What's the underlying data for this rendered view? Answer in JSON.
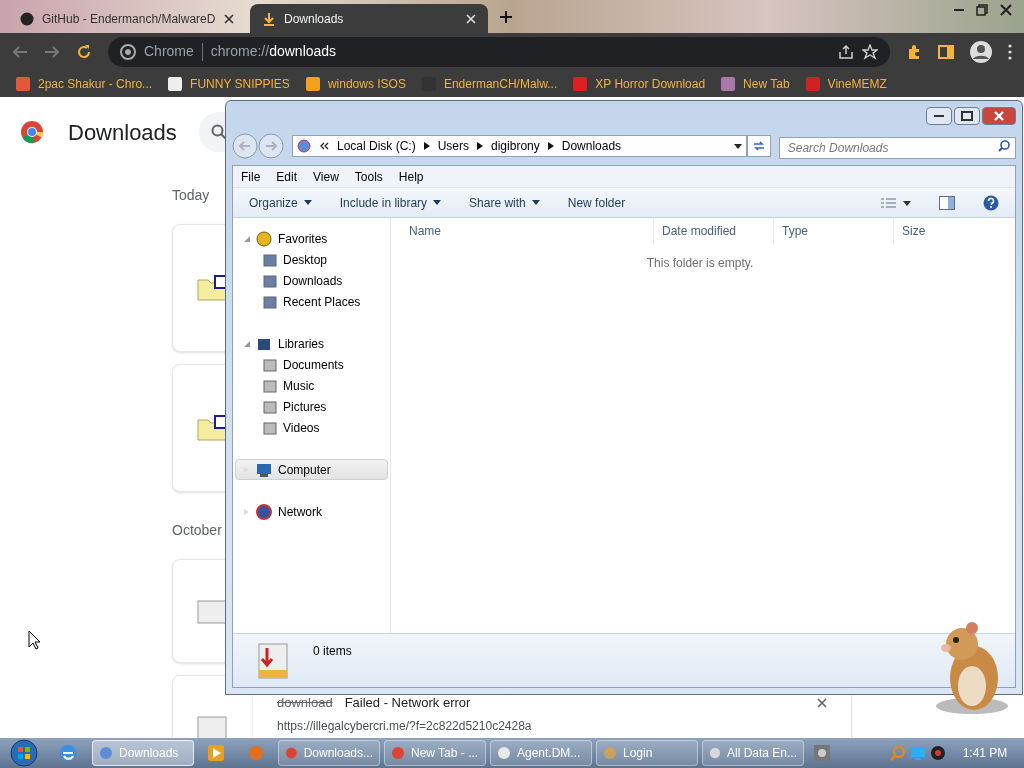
{
  "chrome": {
    "tabs": [
      {
        "title": "GitHub - Endermanch/MalwareD",
        "selected": false
      },
      {
        "title": "Downloads",
        "selected": true
      }
    ],
    "omnibox": {
      "site_label": "Chrome",
      "url_scheme": "chrome://",
      "url_host": "downloads"
    },
    "bookmarks": [
      "2pac Shakur - Chro...",
      "FUNNY SNIPPIES",
      "windows ISOS",
      "EndermanCH/Malw...",
      "XP Horror Download",
      "New Tab",
      "VineMEMZ"
    ],
    "page": {
      "title": "Downloads",
      "sections": [
        {
          "heading": "Today"
        },
        {
          "heading": "October"
        }
      ],
      "failed_item": {
        "name": "download",
        "status": "Failed - Network error",
        "url": "https://illegalcybercri.me/?f=2c822d5210c2428a"
      }
    }
  },
  "explorer": {
    "breadcrumb": [
      "Local Disk (C:)",
      "Users",
      "digibrony",
      "Downloads"
    ],
    "search": {
      "placeholder": "Search Downloads"
    },
    "menu": [
      "File",
      "Edit",
      "View",
      "Tools",
      "Help"
    ],
    "commands": [
      {
        "label": "Organize",
        "dropdown": true
      },
      {
        "label": "Include in library",
        "dropdown": true
      },
      {
        "label": "Share with",
        "dropdown": true
      },
      {
        "label": "New folder",
        "dropdown": false
      }
    ],
    "columns": [
      "Name",
      "Date modified",
      "Type",
      "Size"
    ],
    "empty_message": "This folder is empty.",
    "nav": [
      {
        "label": "Favorites",
        "selected": false,
        "children": [
          {
            "label": "Desktop",
            "selected": false
          },
          {
            "label": "Downloads",
            "selected": false
          },
          {
            "label": "Recent Places",
            "selected": false
          }
        ]
      },
      {
        "label": "Libraries",
        "selected": false,
        "children": [
          {
            "label": "Documents",
            "selected": false
          },
          {
            "label": "Music",
            "selected": false
          },
          {
            "label": "Pictures",
            "selected": false
          },
          {
            "label": "Videos",
            "selected": false
          }
        ]
      },
      {
        "label": "Computer",
        "selected": true
      },
      {
        "label": "Network",
        "selected": false
      }
    ],
    "status": "0 items"
  },
  "taskbar": {
    "items": [
      {
        "label": "Downloads",
        "selected": true
      },
      {
        "label": "Downloads...",
        "selected": false
      },
      {
        "label": "New Tab - ...",
        "selected": false
      },
      {
        "label": "Agent.DM...",
        "selected": false
      },
      {
        "label": "Login",
        "selected": false
      },
      {
        "label": "All Data En...",
        "selected": false
      }
    ],
    "clock": "1:41 PM"
  }
}
